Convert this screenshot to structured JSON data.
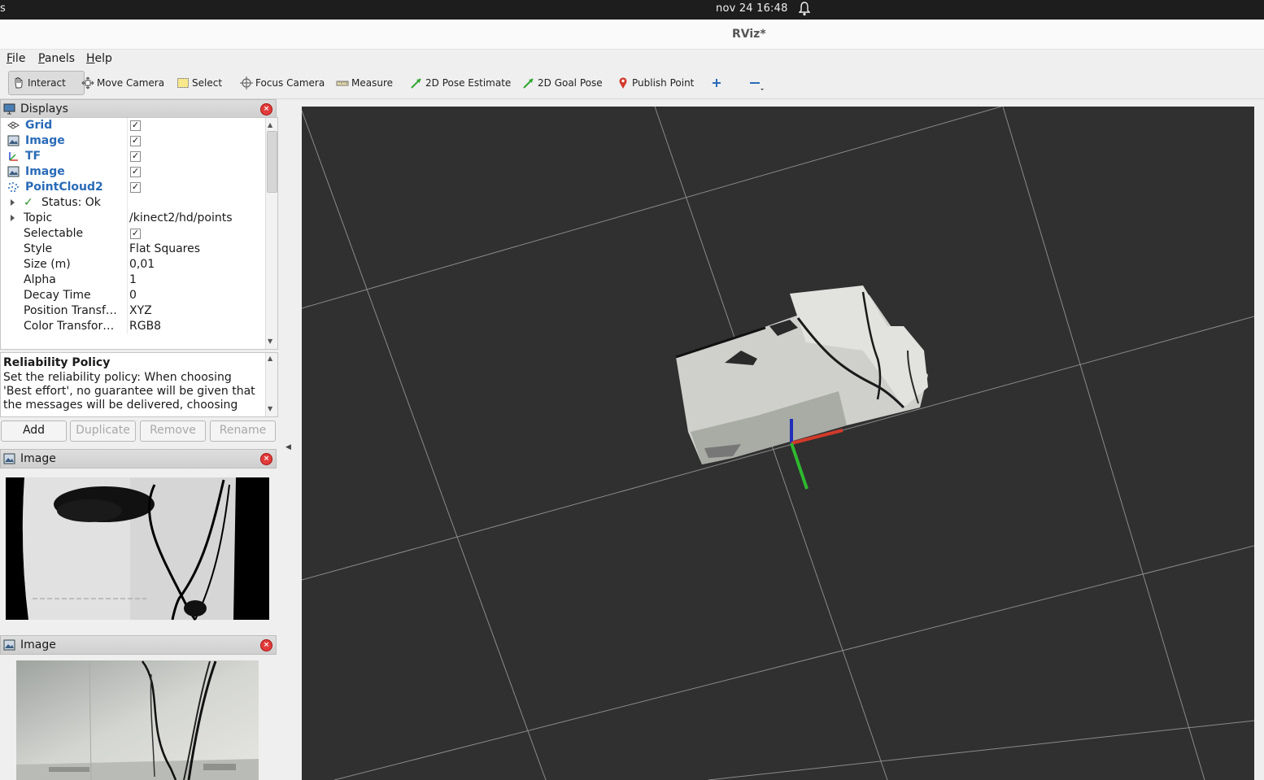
{
  "system": {
    "left_text": "s",
    "clock": "nov 24  16:48",
    "bell_icon": "bell-icon"
  },
  "window": {
    "title": "RViz*"
  },
  "menu": {
    "items": [
      {
        "accel": "F",
        "rest": "ile"
      },
      {
        "accel": "P",
        "rest": "anels"
      },
      {
        "accel": "H",
        "rest": "elp"
      }
    ]
  },
  "toolbar": {
    "tools": [
      {
        "label": "Interact",
        "icon": "hand-cursor-icon",
        "active": true
      },
      {
        "label": "Move Camera",
        "icon": "move-camera-icon"
      },
      {
        "label": "Select",
        "icon": "select-box-icon"
      },
      {
        "label": "Focus Camera",
        "icon": "focus-crosshair-icon"
      },
      {
        "label": "Measure",
        "icon": "ruler-icon"
      },
      {
        "label": "2D Pose Estimate",
        "icon": "green-arrow-icon"
      },
      {
        "label": "2D Goal Pose",
        "icon": "green-arrow-icon"
      },
      {
        "label": "Publish Point",
        "icon": "map-pin-icon"
      }
    ],
    "plus_icon": "plus-icon",
    "minus_icon": "minus-icon",
    "accent_green": "#2fa52f",
    "accent_red": "#d23a2a",
    "accent_blue": "#2a6bb8"
  },
  "displays": {
    "title": "Displays",
    "items": [
      {
        "name": "Grid",
        "icon": "grid-icon",
        "checked": true
      },
      {
        "name": "Image",
        "icon": "image-icon",
        "checked": true
      },
      {
        "name": "TF",
        "icon": "axes-icon",
        "checked": true
      },
      {
        "name": "Image",
        "icon": "image-icon",
        "checked": true
      },
      {
        "name": "PointCloud2",
        "icon": "pointcloud-icon",
        "checked": true
      }
    ],
    "properties": {
      "status": "Status: Ok",
      "topic_label": "Topic",
      "topic_value": "/kinect2/hd/points",
      "selectable_label": "Selectable",
      "style_label": "Style",
      "style_value": "Flat Squares",
      "size_label": "Size (m)",
      "size_value": "0,01",
      "alpha_label": "Alpha",
      "alpha_value": "1",
      "decay_label": "Decay Time",
      "decay_value": "0",
      "position_label": "Position Transf…",
      "position_value": "XYZ",
      "color_label": "Color Transfor…",
      "color_value": "RGB8"
    },
    "description": {
      "title": "Reliability Policy",
      "text": "Set the reliability policy: When choosing 'Best effort', no guarantee will be given that the messages will be delivered, choosing"
    },
    "buttons": {
      "add": "Add",
      "duplicate": "Duplicate",
      "remove": "Remove",
      "rename": "Rename"
    }
  },
  "image_panels": [
    {
      "title": "Image"
    },
    {
      "title": "Image"
    }
  ]
}
